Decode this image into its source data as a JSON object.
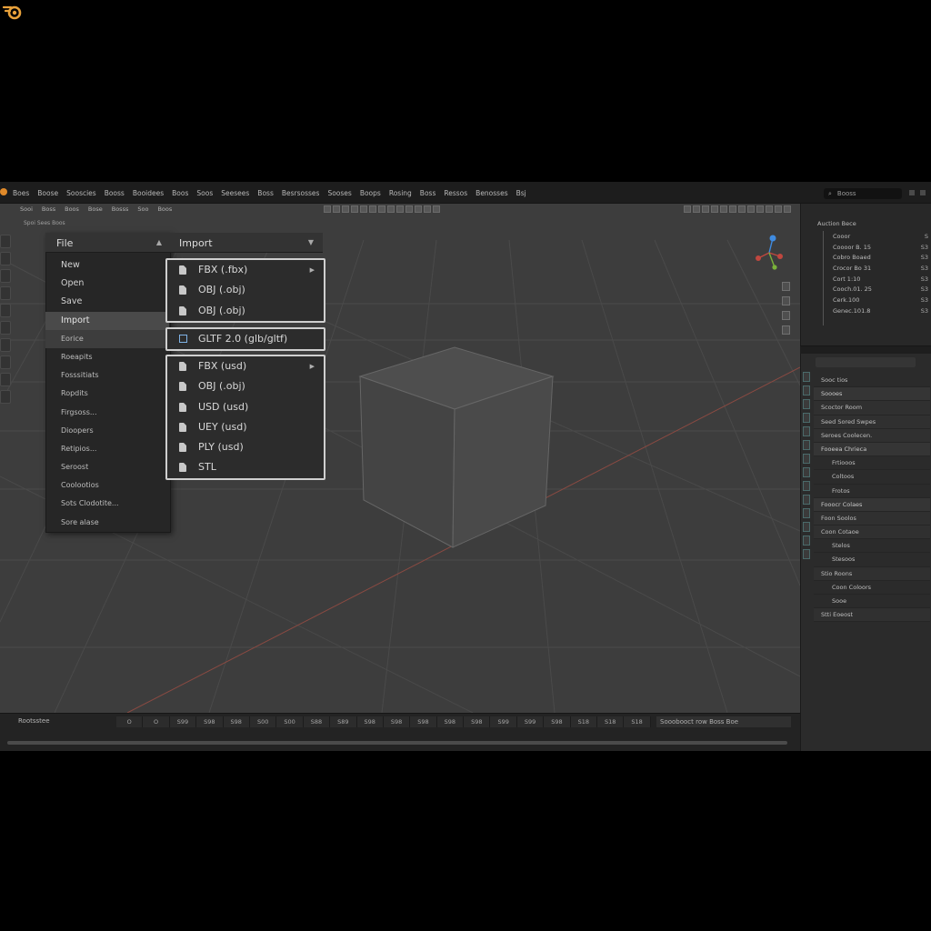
{
  "topbar": {
    "menus": [
      "Boes",
      "Boose",
      "Sooscies",
      "Booss",
      "Booidees",
      "Boos",
      "Soos",
      "Seesees",
      "Boss",
      "Besrsosses",
      "Sooses",
      "Boops",
      "Rosing",
      "Boss",
      "Ressos",
      "Benosses",
      "Bsj"
    ],
    "search_value": "Booss"
  },
  "viewport": {
    "header_items": [
      "Sooi",
      "Boss",
      "Boos",
      "Bose",
      "Bosss",
      "Soo",
      "Boos"
    ],
    "header2": "Spoi  Sees  Boos"
  },
  "file_menu": {
    "label": "File",
    "items": [
      {
        "label": "New",
        "style": "normal"
      },
      {
        "label": "Open",
        "style": "normal"
      },
      {
        "label": "Save",
        "style": "normal"
      },
      {
        "label": "Import",
        "style": "active"
      },
      {
        "label": "Eorice",
        "style": "sub"
      },
      {
        "label": "Roeapits",
        "style": "small"
      },
      {
        "label": "Fosssitiats",
        "style": "small"
      },
      {
        "label": "Ropdits",
        "style": "small"
      },
      {
        "label": "Firgsoss...",
        "style": "small"
      },
      {
        "label": "Dioopers",
        "style": "small"
      },
      {
        "label": "Retipios...",
        "style": "small"
      },
      {
        "label": "Seroost",
        "style": "small"
      },
      {
        "label": "Coolootios",
        "style": "small"
      },
      {
        "label": "Sots Clodotite...",
        "style": "small"
      },
      {
        "label": "Sore alase",
        "style": "small"
      }
    ]
  },
  "import_menu": {
    "label": "Import",
    "group1": [
      {
        "label": "FBX (.fbx)",
        "submenu": true
      },
      {
        "label": "OBJ (.obj)",
        "submenu": false
      },
      {
        "label": "OBJ (.obj)",
        "submenu": false
      }
    ],
    "gltf": {
      "label": "GLTF 2.0 (glb/gltf)"
    },
    "group2": [
      {
        "label": "FBX (usd)",
        "submenu": true
      },
      {
        "label": "OBJ (.obj)",
        "submenu": false
      },
      {
        "label": "USD (usd)",
        "submenu": false
      },
      {
        "label": "UEY (usd)",
        "submenu": false
      },
      {
        "label": "PLY (usd)",
        "submenu": false
      },
      {
        "label": "STL",
        "submenu": false
      }
    ]
  },
  "outliner": {
    "title": "Auction Bece",
    "rows": [
      {
        "label": "Cooor",
        "value": "S"
      },
      {
        "label": "Coooor B. 15",
        "value": "S3"
      },
      {
        "label": "Cobro Boaed",
        "value": "S3"
      },
      {
        "label": "Crocor Bo 31",
        "value": "S3"
      },
      {
        "label": "Cort 1:10",
        "value": "S3"
      },
      {
        "label": "Cooch.01. 25",
        "value": "S3"
      },
      {
        "label": "Cerk.100",
        "value": "S3"
      },
      {
        "label": "Genec.101.8",
        "value": "S3"
      }
    ]
  },
  "properties": {
    "rows": [
      {
        "label": "Sooc tios",
        "style": "plain"
      },
      {
        "label": "Soooes",
        "style": "hd"
      },
      {
        "label": "Scoctor Room",
        "style": "fld"
      },
      {
        "label": "Seed Sored Swpes",
        "style": "fld"
      },
      {
        "label": "Seroes Coolecen.",
        "style": "fld"
      },
      {
        "label": "Fooeea Chrieca",
        "style": "hd"
      },
      {
        "label": "Frtiooos",
        "style": "in"
      },
      {
        "label": "Coltoos",
        "style": "in"
      },
      {
        "label": "Frotos",
        "style": "in"
      },
      {
        "label": "Fooocr Colaes",
        "style": "hd"
      },
      {
        "label": "Foon Soolos",
        "style": "fld"
      },
      {
        "label": "Coon Cotaoe",
        "style": "fld"
      },
      {
        "label": "Stelos",
        "style": "in"
      },
      {
        "label": "Stesoos",
        "style": "in"
      },
      {
        "label": "Stio Roons",
        "style": "fld"
      },
      {
        "label": "Coon Coloors",
        "style": "in"
      },
      {
        "label": "Sooe",
        "style": "in"
      },
      {
        "label": "Stti Eoeost",
        "style": "fld"
      }
    ]
  },
  "timeline": {
    "label": "Rootsstee",
    "frames": [
      "O",
      "O",
      "S99",
      "S98",
      "S98",
      "S00",
      "S00",
      "S88",
      "S89",
      "S98",
      "S98",
      "S98",
      "S98",
      "S98",
      "S99",
      "S99",
      "S98",
      "S18",
      "S18",
      "S18"
    ],
    "field": "Sooobooct row Boss Boe"
  },
  "colors": {
    "background": "#3d3d3d",
    "menu_bg": "#262626",
    "highlight": "#4a4a4a",
    "accent_orange": "#e08a2a",
    "x_axis": "#c0473f",
    "y_axis": "#7ab23a",
    "z_axis": "#3f8be0"
  },
  "icons": [
    "blender-logo-icon",
    "file-icon",
    "gltf-export-icon",
    "chevron-down-icon",
    "submenu-arrow-icon",
    "axis-gizmo-icon",
    "search-icon"
  ]
}
